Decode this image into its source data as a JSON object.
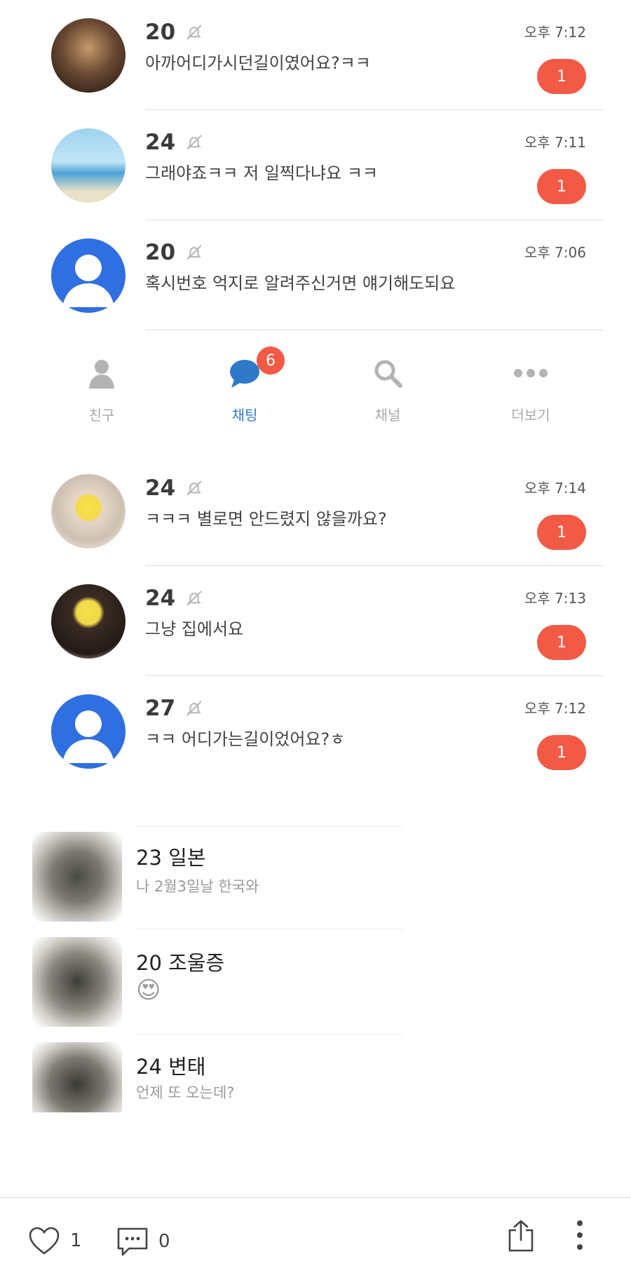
{
  "upper_chats": [
    {
      "age": "20",
      "message": "아까어디가시던길이였어요?ㅋㅋ",
      "time": "오후 7:12",
      "unread": "1",
      "avatar": "photo-room"
    },
    {
      "age": "24",
      "message": "그래야죠ㅋㅋ 저 일찍다냐요 ㅋㅋ",
      "time": "오후 7:11",
      "unread": "1",
      "avatar": "photo-beach"
    },
    {
      "age": "20",
      "message": "혹시번호 억지로 알려주신거면 얘기해도되요",
      "time": "오후 7:06",
      "unread": "",
      "avatar": "default-person"
    }
  ],
  "tabs": [
    {
      "label": "친구",
      "icon": "person-icon"
    },
    {
      "label": "채팅",
      "icon": "chat-bubble-icon",
      "badge": "6"
    },
    {
      "label": "채널",
      "icon": "search-icon"
    },
    {
      "label": "더보기",
      "icon": "more-dots-icon"
    }
  ],
  "lower_chats": [
    {
      "age": "24",
      "message": "ㅋㅋㅋ 별로면 안드렸지 않을까요?",
      "time": "오후 7:14",
      "unread": "1",
      "avatar": "photo-woman-1"
    },
    {
      "age": "24",
      "message": "그냥 집에서요",
      "time": "오후 7:13",
      "unread": "1",
      "avatar": "photo-woman-2"
    },
    {
      "age": "27",
      "message": "ㅋㅋ 어디가는길이었어요?ㅎ",
      "time": "오후 7:12",
      "unread": "1",
      "avatar": "default-person"
    }
  ],
  "plain_chats": [
    {
      "name": "23 일본",
      "message": "나 2월3일날 한국와"
    },
    {
      "name": "20 조울증",
      "message": "😍"
    },
    {
      "name": "24 변태",
      "message": "언제 또 오는데?"
    }
  ],
  "bottom_bar": {
    "likes": "1",
    "comments": "0"
  },
  "colors": {
    "unread_badge": "#f25a45",
    "active_tab": "#2f79c9",
    "default_avatar": "#2f6fe0"
  }
}
